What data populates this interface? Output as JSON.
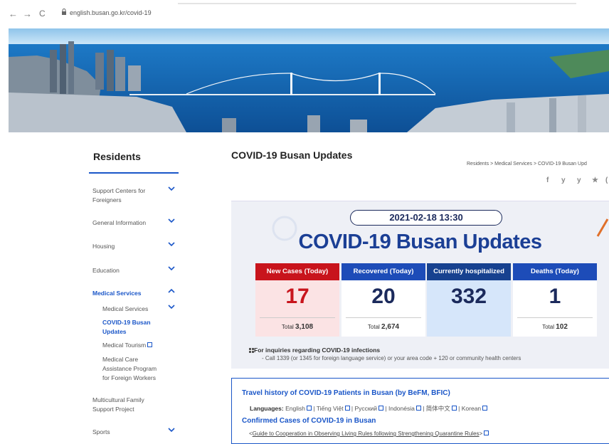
{
  "browser": {
    "url": "english.busan.go.kr/covid-19"
  },
  "sidebar": {
    "title": "Residents",
    "items": [
      {
        "label": "Support Centers for Foreigners"
      },
      {
        "label": "General Information"
      },
      {
        "label": "Housing"
      },
      {
        "label": "Education"
      },
      {
        "label": "Medical Services"
      },
      {
        "label": "Multicultural Family Support Project"
      },
      {
        "label": "Sports"
      }
    ],
    "sub_items": [
      {
        "label": "Medical Services"
      },
      {
        "label": "COVID-19 Busan Updates"
      },
      {
        "label": "Medical Tourism"
      },
      {
        "label": "Medical Care Assistance Program for Foreign Workers"
      }
    ]
  },
  "main": {
    "title": "COVID-19 Busan Updates",
    "breadcrumb": "Residents > Medical Services > COVID-19 Busan Upd",
    "social": [
      "f",
      "y",
      "y",
      "★",
      "("
    ],
    "date": "2021-02-18 13:30",
    "heading": "COVID-19 Busan Updates",
    "stats": [
      {
        "header": "New Cases (Today)",
        "value": "17",
        "total_label": "Total",
        "total": "3,108",
        "head_color": "#c8141c",
        "body_color": "#fbe3e4",
        "num_color": "#c8141c"
      },
      {
        "header": "Recovered (Today)",
        "value": "20",
        "total_label": "Total",
        "total": "2,674",
        "head_color": "#1d4cb8",
        "body_color": "#ffffff",
        "num_color": "#1b2a5c"
      },
      {
        "header": "Currently hospitalized",
        "value": "332",
        "total_label": "",
        "total": "",
        "head_color": "#17418f",
        "body_color": "#d6e6fa",
        "num_color": "#1b2a5c"
      },
      {
        "header": "Deaths (Today)",
        "value": "1",
        "total_label": "Total",
        "total": "102",
        "head_color": "#1d4cb8",
        "body_color": "#ffffff",
        "num_color": "#1b2a5c"
      }
    ],
    "inquiry_title": "For inquiries regarding COVID-19 infections",
    "inquiry_text": "- Call 1339 (or 1345 for foreign language service) or your area code + 120 or community health centers",
    "travel_title": "Travel history of COVID-19 Patients in Busan (by BeFM, BFIC)",
    "languages_label": "Languages:",
    "languages": [
      "English",
      "Tiếng Việt",
      "Русский",
      "Indonésia",
      "简体中文",
      "Korean"
    ],
    "confirmed_title": "Confirmed Cases of COVID-19 in Busan",
    "guide_link": "Guide to Cooperation in Observing Living Rules following Strengthening Quarantine Rules"
  }
}
